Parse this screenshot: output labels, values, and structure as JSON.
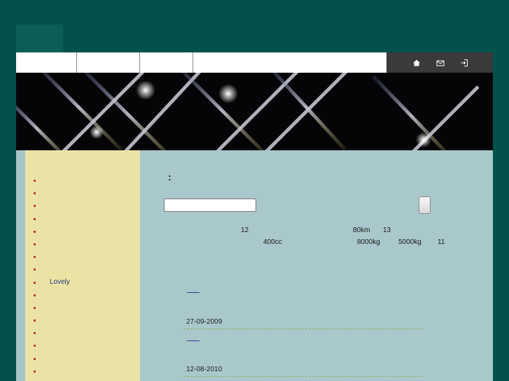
{
  "sidebar": {
    "items": [
      {
        "label": ""
      },
      {
        "label": ""
      },
      {
        "label": ""
      },
      {
        "label": ""
      },
      {
        "label": ""
      },
      {
        "label": ""
      },
      {
        "label": ""
      },
      {
        "label": ""
      },
      {
        "label": "Lovely"
      },
      {
        "label": ""
      },
      {
        "label": ""
      },
      {
        "label": ""
      },
      {
        "label": ""
      },
      {
        "label": ""
      },
      {
        "label": ""
      },
      {
        "label": ""
      }
    ]
  },
  "main": {
    "heading_colon": ":",
    "search": {
      "placeholder": ""
    },
    "specs": {
      "n12": "12",
      "km": "80km",
      "n13": "13",
      "cc": "400cc",
      "kg1": "8000kg",
      "kg2": "5000kg",
      "n11": "11"
    },
    "posts": [
      {
        "date": "27-09-2009"
      },
      {
        "date": "12-08-2010"
      }
    ]
  },
  "colors": {
    "background": "#02514b",
    "sidebar": "#ebe3a6",
    "content": "#a9c8cb",
    "icon_bar": "#3a3a3a"
  },
  "icons": [
    "home-icon",
    "mail-icon",
    "login-icon"
  ]
}
